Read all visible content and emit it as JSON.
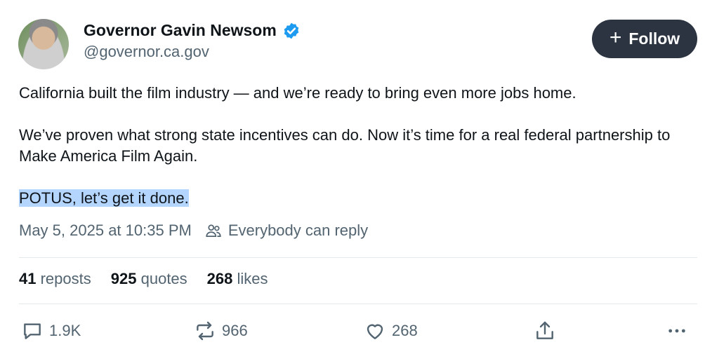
{
  "author": {
    "name": "Governor Gavin Newsom",
    "handle": "@governor.ca.gov",
    "verified_color": "#1d9bf0"
  },
  "follow_button": {
    "label": "Follow",
    "icon": "plus-icon"
  },
  "post": {
    "paragraph_1": "California built the film industry — and we’re ready to bring even more jobs home.",
    "paragraph_2": "We’ve proven what strong state incentives can do. Now it’s time for a real federal partnership to Make America Film Again.",
    "paragraph_3": "POTUS, let’s get it done.",
    "timestamp": "May 5, 2025 at 10:35 PM",
    "reply_setting": "Everybody can reply"
  },
  "stats": {
    "reposts_count": "41",
    "reposts_label": "reposts",
    "quotes_count": "925",
    "quotes_label": "quotes",
    "likes_count": "268",
    "likes_label": "likes"
  },
  "actions": {
    "reply_count": "1.9K",
    "repost_count": "966",
    "like_count": "268"
  },
  "colors": {
    "follow_bg": "#2b3440",
    "highlight": "#b4d5fe",
    "muted": "#536471"
  }
}
